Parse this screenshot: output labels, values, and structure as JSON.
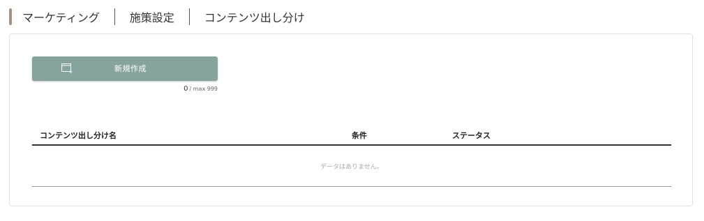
{
  "breadcrumb": {
    "items": [
      "マーケティング",
      "施策設定",
      "コンテンツ出し分け"
    ]
  },
  "toolbar": {
    "create_label": "新規作成",
    "create_icon": "window-plus-icon"
  },
  "counter": {
    "current": "0",
    "max_text": "/ max 999"
  },
  "table": {
    "columns": [
      "コンテンツ出し分け名",
      "条件",
      "ステータス"
    ],
    "rows": [],
    "empty_message": "データはありません。"
  },
  "colors": {
    "accent": "#a8917a",
    "button": "#86a39e",
    "panel_border": "#e1e1e1"
  }
}
